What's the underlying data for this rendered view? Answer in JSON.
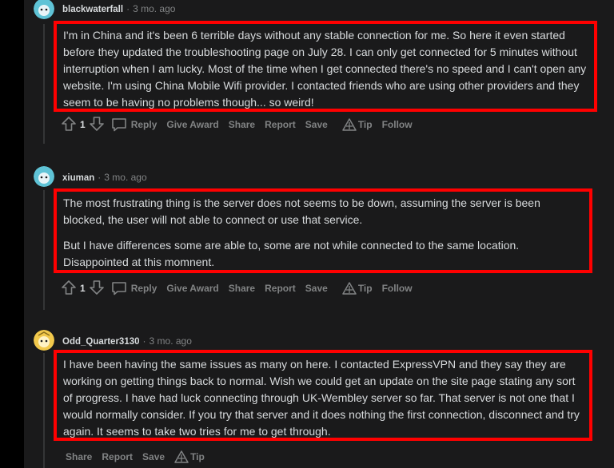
{
  "colors": {
    "background": "#1a1a1b",
    "page": "#000000",
    "text": "#d7dadc",
    "muted": "#818384",
    "highlight_box": "#ff0000"
  },
  "comments": [
    {
      "author": "blackwaterfall",
      "separator": "·",
      "time": "3 mo. ago",
      "avatar_icon": "snoo-avatar-cyan",
      "paragraphs": [
        "I'm in China and it's been 6 terrible days without any stable connection for me. So here it even started before they updated the troubleshooting page on July 28. I can only get connected for 5 minutes without interruption when I am lucky. Most of the time when I get connected there's no speed and I can't open any website. I'm using China Mobile Wifi provider. I contacted friends who are using other providers and they seem to be having no problems though... so weird!"
      ],
      "score": "1",
      "actions": {
        "reply": "Reply",
        "award": "Give Award",
        "share": "Share",
        "report": "Report",
        "save": "Save",
        "tip": "Tip",
        "follow": "Follow"
      }
    },
    {
      "author": "xiuman",
      "separator": "·",
      "time": "3 mo. ago",
      "avatar_icon": "snoo-avatar-cyan",
      "paragraphs": [
        "The most frustrating thing is the server does not seems to be down, assuming the server is been blocked, the user will not able to connect or use that service.",
        "But I have differences some are able to, some are not while connected to the same location. Disappointed at this momnent."
      ],
      "score": "1",
      "actions": {
        "reply": "Reply",
        "award": "Give Award",
        "share": "Share",
        "report": "Report",
        "save": "Save",
        "tip": "Tip",
        "follow": "Follow"
      }
    },
    {
      "author": "Odd_Quarter3130",
      "separator": "·",
      "time": "3 mo. ago",
      "avatar_icon": "snoo-avatar-yellow",
      "paragraphs": [
        "I have been having the same issues as many on here. I contacted ExpressVPN and they say they are working on getting things back to normal. Wish we could get an update on the site page stating any sort of progress. I have had luck connecting through UK-Wembley server so far. That server is not one that I would normally consider. If you try that server and it does nothing the first connection, disconnect and try again. It seems to take two tries for me to get through."
      ],
      "actions": {
        "share": "Share",
        "report": "Report",
        "save": "Save",
        "tip": "Tip"
      }
    }
  ]
}
